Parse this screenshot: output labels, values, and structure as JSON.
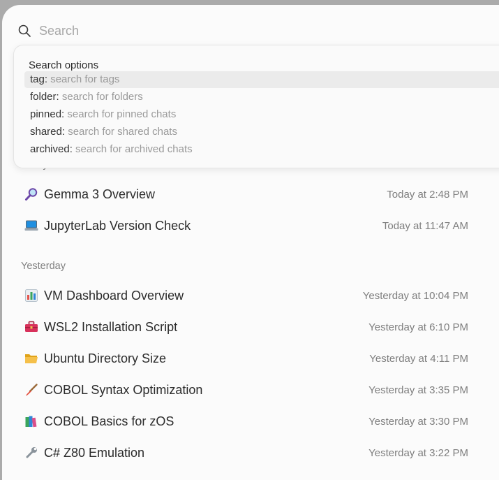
{
  "search": {
    "placeholder": "Search",
    "value": ""
  },
  "options": {
    "title": "Search options",
    "items": [
      {
        "key": "tag:",
        "desc": "search for tags"
      },
      {
        "key": "folder:",
        "desc": "search for folders"
      },
      {
        "key": "pinned:",
        "desc": "search for pinned chats"
      },
      {
        "key": "shared:",
        "desc": "search for shared chats"
      },
      {
        "key": "archived:",
        "desc": "search for archived chats"
      }
    ]
  },
  "sections": [
    {
      "label": "Today",
      "chats": [
        {
          "icon": "magnifying-glass-icon",
          "title": "Gemma 3 Overview",
          "time": "Today at 2:48 PM"
        },
        {
          "icon": "laptop-icon",
          "title": "JupyterLab Version Check",
          "time": "Today at 11:47 AM"
        }
      ]
    },
    {
      "label": "Yesterday",
      "chats": [
        {
          "icon": "bar-chart-icon",
          "title": "VM Dashboard Overview",
          "time": "Yesterday at 10:04 PM"
        },
        {
          "icon": "toolbox-icon",
          "title": "WSL2 Installation Script",
          "time": "Yesterday at 6:10 PM"
        },
        {
          "icon": "open-folder-icon",
          "title": "Ubuntu Directory Size",
          "time": "Yesterday at 4:11 PM"
        },
        {
          "icon": "paintbrush-icon",
          "title": "COBOL Syntax Optimization",
          "time": "Yesterday at 3:35 PM"
        },
        {
          "icon": "books-icon",
          "title": "COBOL Basics for zOS",
          "time": "Yesterday at 3:30 PM"
        },
        {
          "icon": "wrench-icon",
          "title": "C# Z80 Emulation",
          "time": "Yesterday at 3:22 PM"
        }
      ]
    }
  ]
}
